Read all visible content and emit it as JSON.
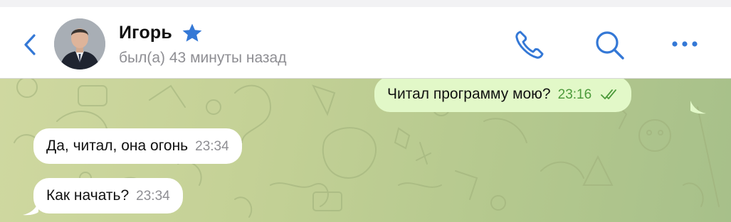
{
  "header": {
    "contact_name": "Игорь",
    "status": "был(а) 43 минуты назад",
    "icons": {
      "back": "chevron-left-icon",
      "verified": "star-icon",
      "call": "phone-icon",
      "search": "search-icon",
      "more": "more-icon"
    },
    "accent_color": "#3478d6"
  },
  "messages": [
    {
      "direction": "out",
      "text": "Читал программу мою?",
      "time": "23:16",
      "status": "read"
    },
    {
      "direction": "in",
      "text": "Да, читал, она огонь",
      "time": "23:34"
    },
    {
      "direction": "in",
      "text": "Как начать?",
      "time": "23:34"
    }
  ],
  "colors": {
    "outgoing_bubble": "#e2f8c8",
    "incoming_bubble": "#ffffff",
    "chat_background": "#c4d196"
  }
}
